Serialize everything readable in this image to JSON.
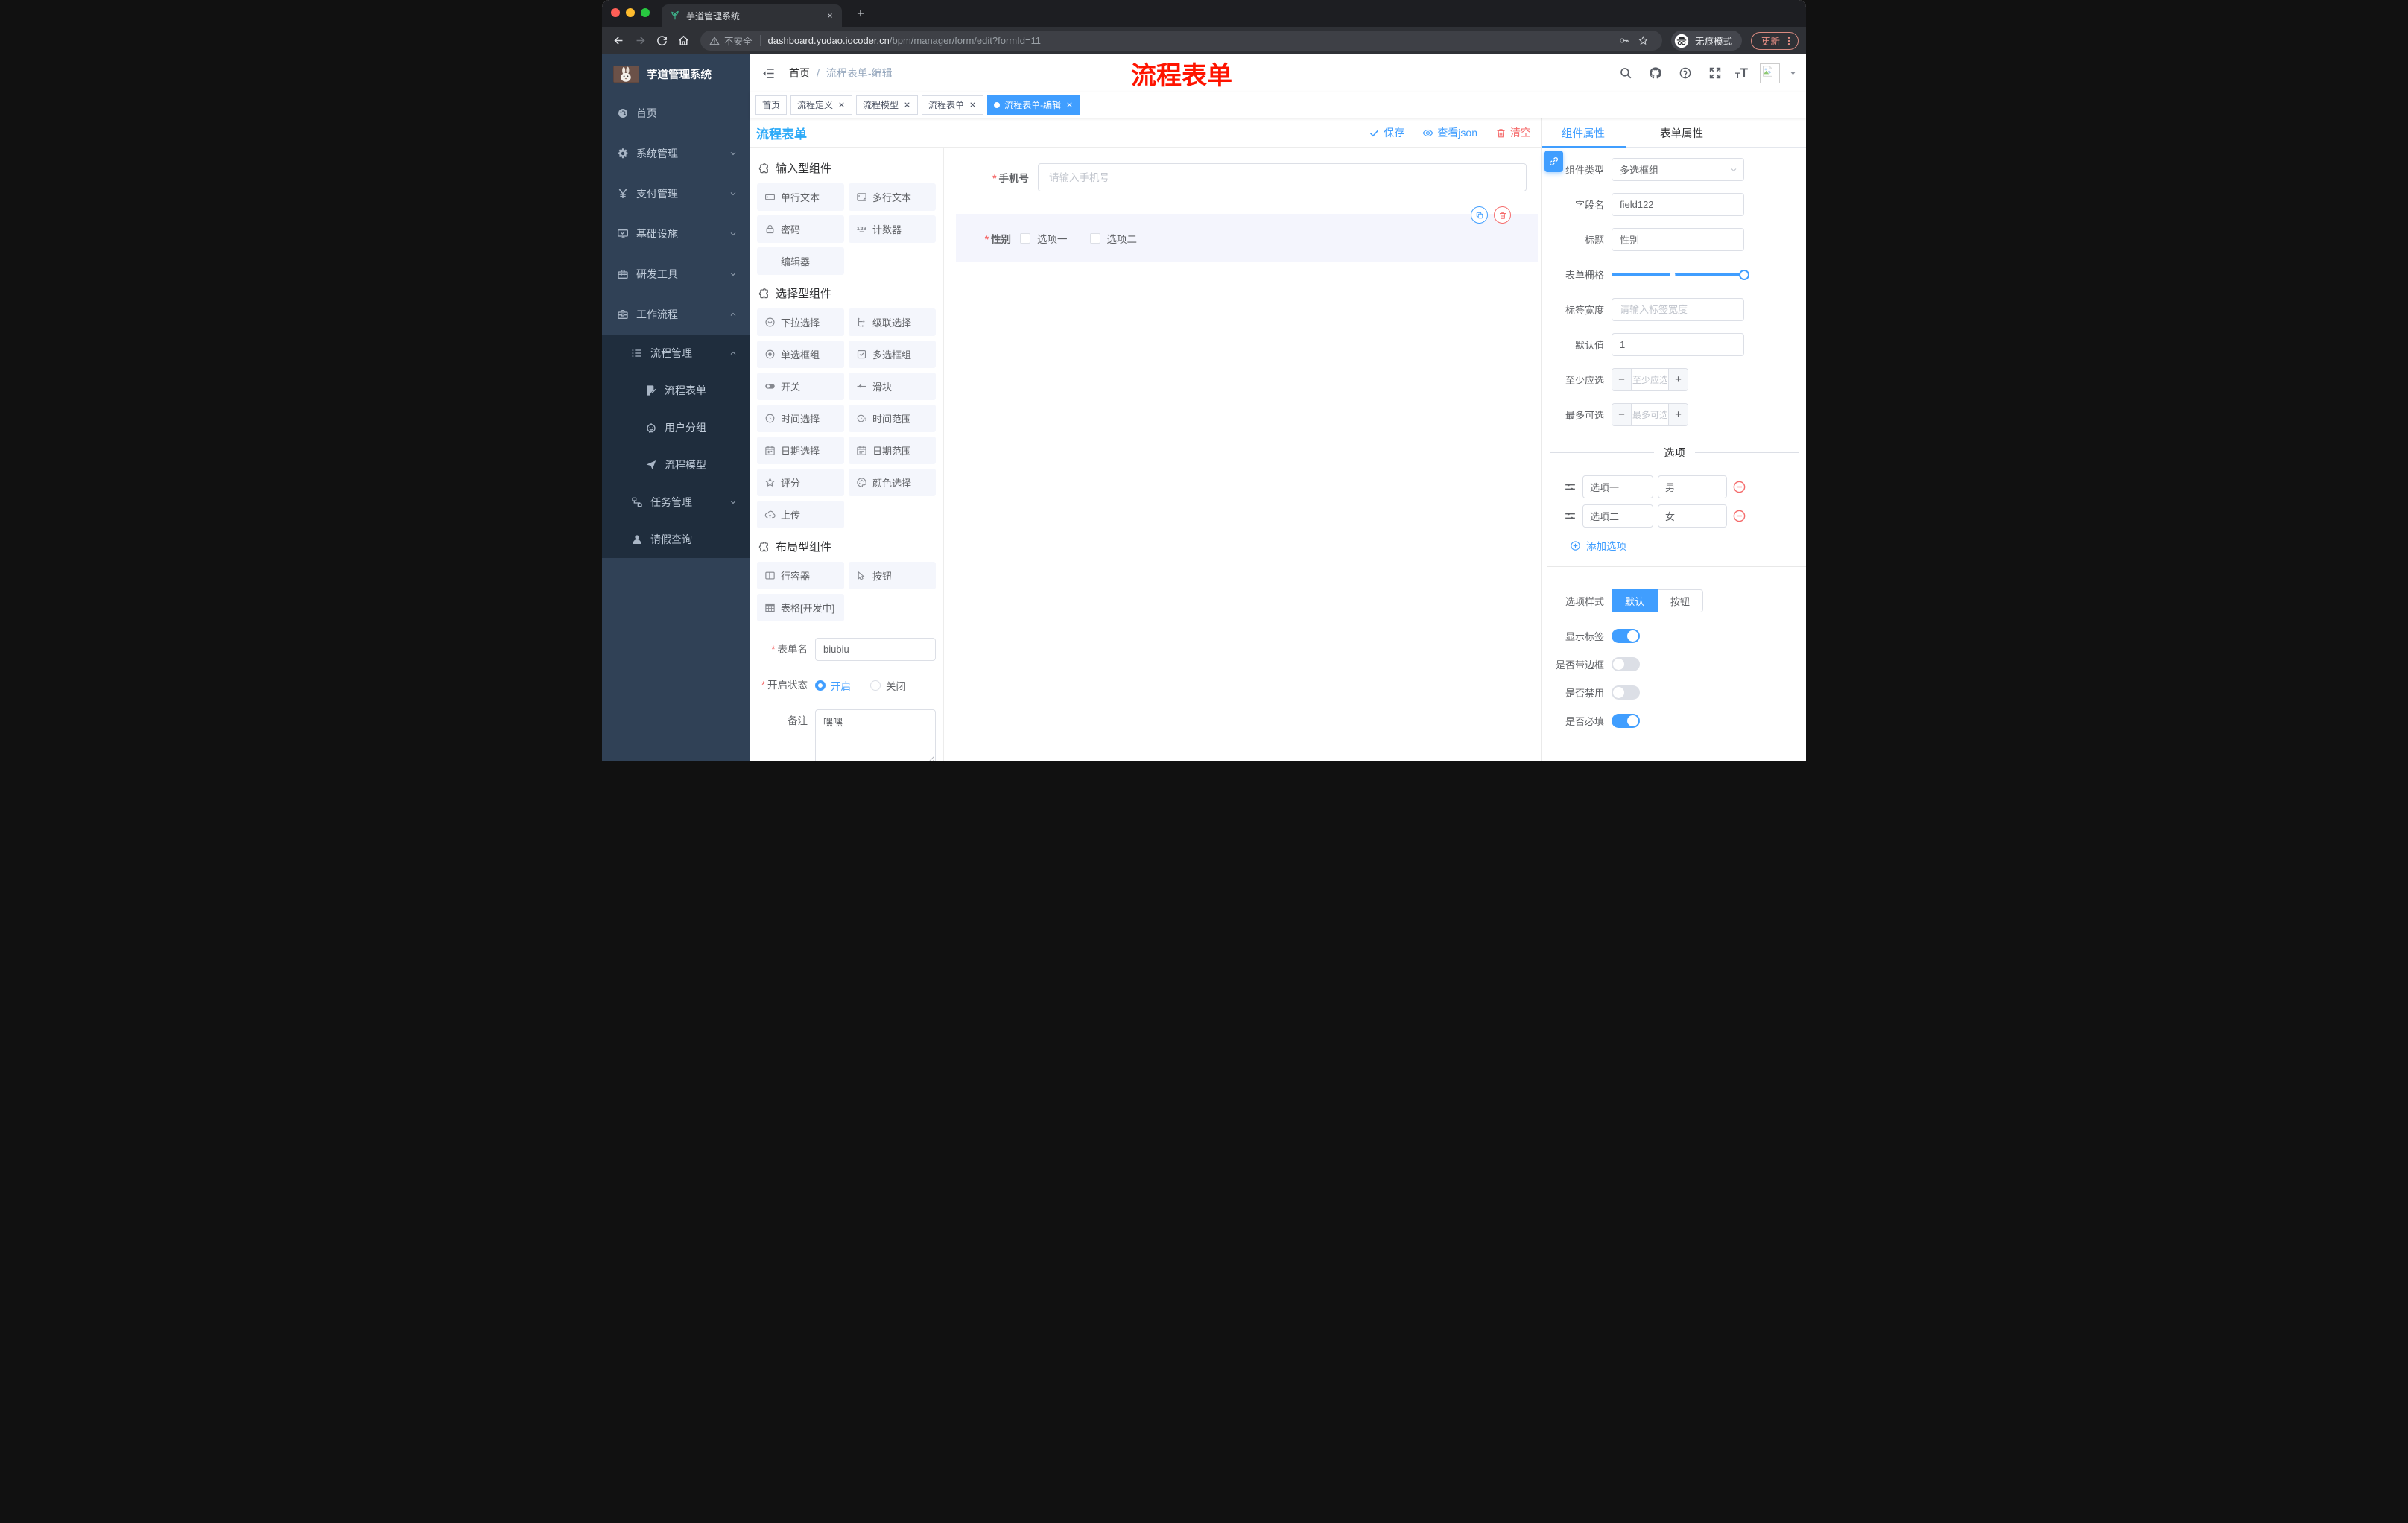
{
  "colors": {
    "primary": "#409eff",
    "danger": "#f56c6c",
    "designer_title": "#2daaf8",
    "annotation_red": "#fe1400",
    "sidebar_bg": "#304156",
    "submenu_bg": "#1f2d3d"
  },
  "browser": {
    "tab_title": "芋道管理系统",
    "security_label": "不安全",
    "url_host": "dashboard.yudao.iocoder.cn",
    "url_path": "/bpm/manager/form/edit?formId=11",
    "incognito_label": "无痕模式",
    "update_label": "更新"
  },
  "header": {
    "breadcrumb_root": "首页",
    "breadcrumb_separator": "/",
    "breadcrumb_current": "流程表单-编辑",
    "annotation": "流程表单",
    "font_size_glyph_small": "T",
    "font_size_glyph_big": "T"
  },
  "sidebar": {
    "app_title": "芋道管理系统",
    "menu": [
      {
        "label": "首页",
        "icon": "home",
        "level": 1
      },
      {
        "label": "系统管理",
        "icon": "gear",
        "level": 1,
        "chevron": "down"
      },
      {
        "label": "支付管理",
        "icon": "yen",
        "level": 1,
        "chevron": "down"
      },
      {
        "label": "基础设施",
        "icon": "monitor",
        "level": 1,
        "chevron": "down"
      },
      {
        "label": "研发工具",
        "icon": "toolbox",
        "level": 1,
        "chevron": "down"
      },
      {
        "label": "工作流程",
        "icon": "briefcase",
        "level": 1,
        "chevron": "up"
      },
      {
        "label": "流程管理",
        "icon": "list",
        "level": 2,
        "chevron": "up"
      },
      {
        "label": "流程表单",
        "icon": "form",
        "level": 3
      },
      {
        "label": "用户分组",
        "icon": "group",
        "level": 3
      },
      {
        "label": "流程模型",
        "icon": "plane",
        "level": 3
      },
      {
        "label": "任务管理",
        "icon": "flow",
        "level": 2,
        "chevron": "down"
      },
      {
        "label": "请假查询",
        "icon": "user",
        "level": 2
      }
    ]
  },
  "tags": [
    {
      "label": "首页",
      "closable": false,
      "active": false
    },
    {
      "label": "流程定义",
      "closable": true,
      "active": false
    },
    {
      "label": "流程模型",
      "closable": true,
      "active": false
    },
    {
      "label": "流程表单",
      "closable": true,
      "active": false
    },
    {
      "label": "流程表单-编辑",
      "closable": true,
      "active": true
    }
  ],
  "designer": {
    "title": "流程表单",
    "actions": {
      "save": "保存",
      "view_json": "查看json",
      "clear": "清空"
    },
    "components": {
      "input": {
        "title": "输入型组件",
        "items": [
          {
            "label": "单行文本",
            "icon": "text-input"
          },
          {
            "label": "多行文本",
            "icon": "textarea"
          },
          {
            "label": "密码",
            "icon": "lock"
          },
          {
            "label": "计数器",
            "icon": "number"
          },
          {
            "label": "编辑器",
            "icon": ""
          }
        ]
      },
      "select": {
        "title": "选择型组件",
        "items": [
          {
            "label": "下拉选择",
            "icon": "select"
          },
          {
            "label": "级联选择",
            "icon": "cascader"
          },
          {
            "label": "单选框组",
            "icon": "radio"
          },
          {
            "label": "多选框组",
            "icon": "checkbox"
          },
          {
            "label": "开关",
            "icon": "switch"
          },
          {
            "label": "滑块",
            "icon": "slider"
          },
          {
            "label": "时间选择",
            "icon": "time"
          },
          {
            "label": "时间范围",
            "icon": "time-range"
          },
          {
            "label": "日期选择",
            "icon": "date"
          },
          {
            "label": "日期范围",
            "icon": "date-range"
          },
          {
            "label": "评分",
            "icon": "rate"
          },
          {
            "label": "颜色选择",
            "icon": "color"
          },
          {
            "label": "上传",
            "icon": "upload"
          }
        ]
      },
      "layout": {
        "title": "布局型组件",
        "items": [
          {
            "label": "行容器",
            "icon": "row"
          },
          {
            "label": "按钮",
            "icon": "button"
          },
          {
            "label": "表格[开发中]",
            "icon": "table"
          }
        ]
      }
    },
    "form_info": {
      "name_label": "表单名",
      "name_value": "biubiu",
      "status_label": "开启状态",
      "status_options": [
        {
          "label": "开启",
          "checked": true
        },
        {
          "label": "关闭",
          "checked": false
        }
      ],
      "remark_label": "备注",
      "remark_value": "嘿嘿"
    },
    "canvas": {
      "phone_label": "手机号",
      "phone_placeholder": "请输入手机号",
      "gender_label": "性别",
      "gender_options": [
        "选项一",
        "选项二"
      ]
    },
    "properties": {
      "tab_component": "组件属性",
      "tab_form": "表单属性",
      "component_type_label": "组件类型",
      "component_type_value": "多选框组",
      "field_name_label": "字段名",
      "field_name_value": "field122",
      "title_label": "标题",
      "title_value": "性别",
      "grid_label": "表单栅格",
      "label_width_label": "标签宽度",
      "label_width_placeholder": "请输入标签宽度",
      "default_label": "默认值",
      "default_value": "1",
      "min_label": "至少应选",
      "min_placeholder": "至少应选",
      "max_label": "最多可选",
      "max_placeholder": "最多可选",
      "options_title": "选项",
      "option_rows": [
        {
          "label": "选项一",
          "value": "男"
        },
        {
          "label": "选项二",
          "value": "女"
        }
      ],
      "add_option_label": "添加选项",
      "style_label": "选项样式",
      "style_options": [
        {
          "label": "默认",
          "active": true
        },
        {
          "label": "按钮",
          "active": false
        }
      ],
      "switches": [
        {
          "label": "显示标签",
          "on": true
        },
        {
          "label": "是否带边框",
          "on": false
        },
        {
          "label": "是否禁用",
          "on": false
        },
        {
          "label": "是否必填",
          "on": true
        }
      ]
    }
  }
}
